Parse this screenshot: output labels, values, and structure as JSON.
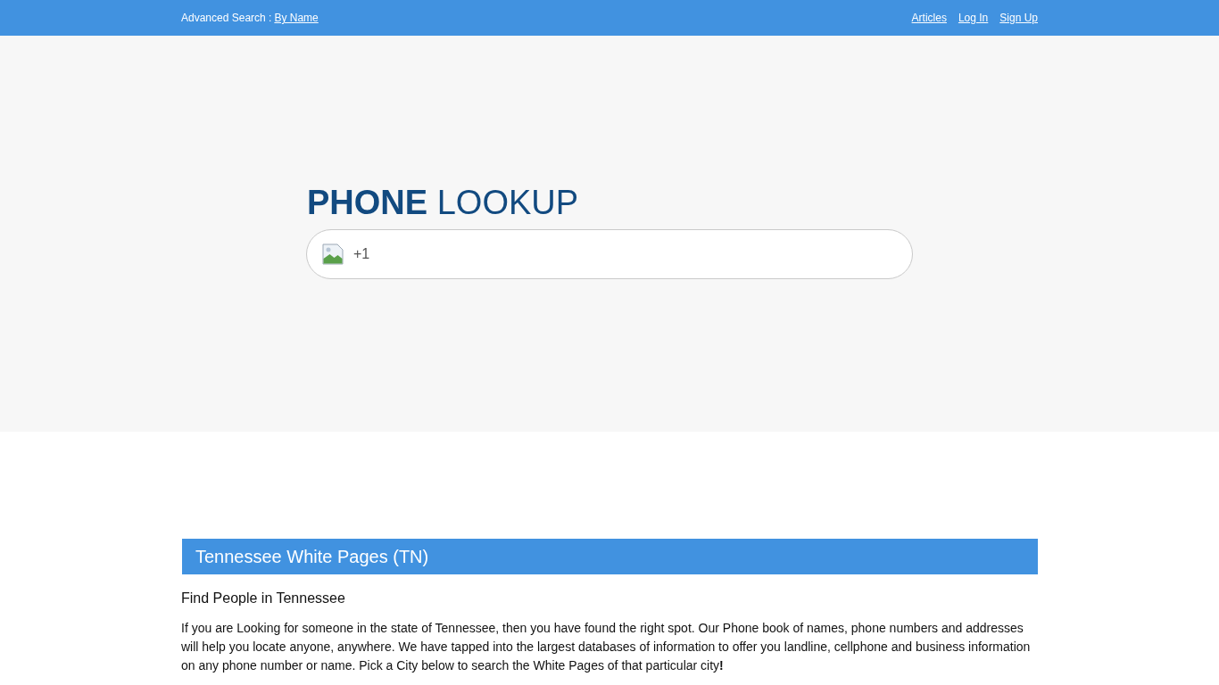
{
  "top_bar": {
    "advanced_search_label": "Advanced Search :",
    "advanced_search_link": "By Name",
    "links": [
      "Articles",
      "Log In",
      "Sign Up"
    ]
  },
  "hero": {
    "title": "**PHONE** LOOKUP",
    "phone_field": {
      "value": "+1"
    }
  },
  "section": {
    "title": "Tennessee White Pages (TN)",
    "subtitle": "Find People in Tennessee",
    "paragraph": "If you are Looking for someone in the state of Tennessee, then you have found the right spot. Our Phone book of names, phone numbers and addresses will help you locate anyone, anywhere. We have tapped into the largest databases of information to offer you landline, cellphone and business information on any phone number or name. Pick a City below to search the White Pages of that particular city**!**"
  }
}
